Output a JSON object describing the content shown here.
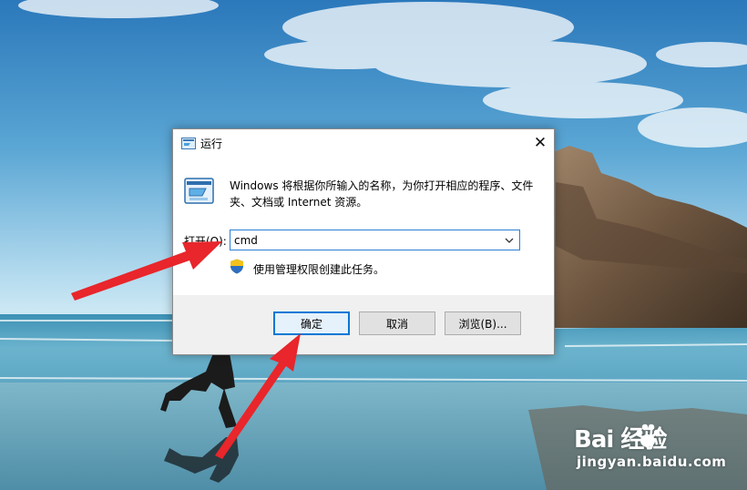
{
  "dialog": {
    "title": "运行",
    "description": "Windows 将根据你所输入的名称，为你打开相应的程序、文件夹、文档或 Internet 资源。",
    "open_label": "打开(O):",
    "command_value": "cmd",
    "admin_note": "使用管理权限创建此任务。",
    "buttons": {
      "ok": "确定",
      "cancel": "取消",
      "browse": "浏览(B)..."
    }
  },
  "watermark": {
    "logo_text": "Bai  经验",
    "site": "jingyan.baidu.com"
  },
  "colors": {
    "accent": "#0078d7",
    "arrow": "#e8262b",
    "sky_top": "#2f7fc0",
    "sky_horizon": "#bfe2f2",
    "sea": "#3a8fb2"
  },
  "icons": [
    "run-icon",
    "close-icon",
    "chevron-down-icon",
    "shield-icon",
    "baidu-paw-icon"
  ]
}
